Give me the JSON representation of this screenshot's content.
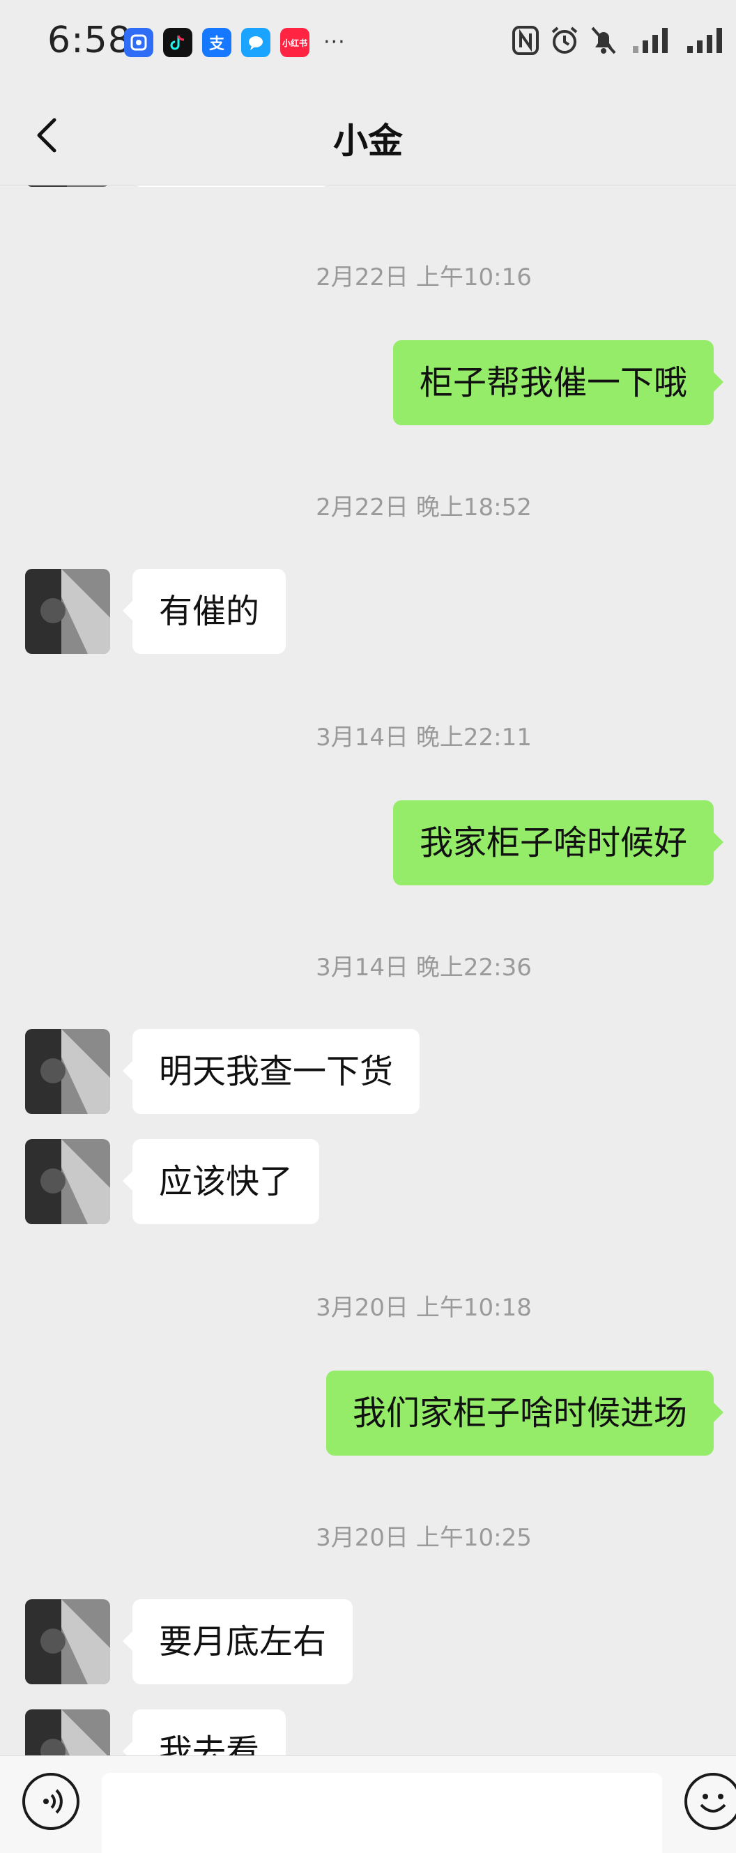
{
  "status_bar": {
    "time": "6:58",
    "notification_apps": [
      "alert-app-icon",
      "douyin-icon",
      "alipay-icon",
      "messages-icon",
      "xiaohongshu-icon"
    ],
    "alipay_glyph": "支",
    "xiaohongshu_glyph": "小红书",
    "more": "···"
  },
  "header": {
    "title": "小金"
  },
  "messages": [
    {
      "type": "timestamp",
      "text": "2月22日 上午10:16"
    },
    {
      "type": "out",
      "text": "柜子帮我催一下哦"
    },
    {
      "type": "timestamp",
      "text": "2月22日 晚上18:52"
    },
    {
      "type": "in",
      "text": "有催的"
    },
    {
      "type": "timestamp",
      "text": "3月14日 晚上22:11"
    },
    {
      "type": "out",
      "text": "我家柜子啥时候好"
    },
    {
      "type": "timestamp",
      "text": "3月14日 晚上22:36"
    },
    {
      "type": "in",
      "text": "明天我查一下货"
    },
    {
      "type": "in",
      "text": "应该快了"
    },
    {
      "type": "timestamp",
      "text": "3月20日 上午10:18"
    },
    {
      "type": "out",
      "text": "我们家柜子啥时候进场"
    },
    {
      "type": "timestamp",
      "text": "3月20日 上午10:25"
    },
    {
      "type": "in",
      "text": "要月底左右"
    },
    {
      "type": "in",
      "text": "我去看"
    }
  ],
  "input": {
    "value": "",
    "placeholder": ""
  },
  "colors": {
    "background": "#ededed",
    "outgoing_bubble": "#95ec69",
    "incoming_bubble": "#ffffff",
    "timestamp_text": "#9a9a9a"
  }
}
